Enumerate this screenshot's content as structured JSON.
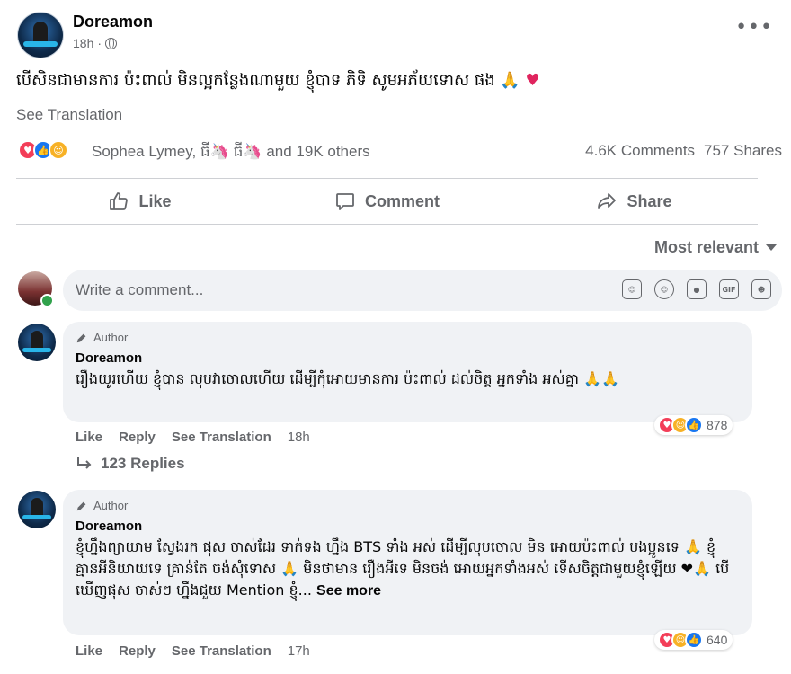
{
  "post": {
    "author": "Doreamon",
    "time": "18h",
    "text": "បើសិនជាមានការ ប៉ះពាល់ មិនល្អកន្លែងណាមួយ ខ្ញុំបាទ ភិទិ សូមអភ័យទោស ផង 🙏",
    "heart": "♥",
    "see_translation": "See Translation",
    "reactors": "Sophea Lymey, ធី🦄 ធី🦄 and 19K others",
    "comments_count": "4.6K Comments",
    "shares_count": "757 Shares",
    "reaction_icons": [
      "love-icon",
      "like-icon",
      "care-icon"
    ],
    "accent_color": "#1877f2"
  },
  "actions": {
    "like": "Like",
    "comment": "Comment",
    "share": "Share"
  },
  "sort": {
    "label": "Most relevant"
  },
  "composer": {
    "placeholder": "Write a comment...",
    "icons": [
      "avatar-sticker-icon",
      "emoji-icon",
      "camera-icon",
      "gif-icon",
      "sticker-icon"
    ],
    "gif_label": "GIF"
  },
  "comments": [
    {
      "badge": "Author",
      "name": "Doreamon",
      "text": "រឿងយូរហើយ ខ្ញុំបាន លុបវាចោលហើយ ដើម្បីកុំអោយមានការ ប៉ះពាល់ ដល់ចិត្ត អ្នកទាំង អស់គ្នា 🙏🙏",
      "like": "Like",
      "reply": "Reply",
      "see_translation": "See Translation",
      "time": "18h",
      "reaction_count": "878",
      "reaction_icons": [
        "love-icon",
        "haha-icon",
        "like-icon"
      ]
    },
    {
      "badge": "Author",
      "name": "Doreamon",
      "text": "ខ្ញុំហ្នឹងព្យាយាម ស្វែងរក ផុស ចាស់ដែរ ទាក់ទង ហ្នឹង BTS ទាំង អស់ ដើម្បីលុបចោល មិន អោយប៉ះពាល់ បងប្អូនទេ 🙏 ខ្ញុំគ្មានអីនិយាយទេ គ្រាន់តែ ចង់សុំទោស 🙏 មិនថាមាន រឿងអីទេ មិនចង់ អោយអ្នកទាំងអស់ ទើសចិត្តជាមួយខ្ញុំឡើយ ❤🙏 បើឃើញផុស ចាស់ៗ ហ្នឹងជួយ Mention ខ្ញុំ...",
      "see_more": "See more",
      "like": "Like",
      "reply": "Reply",
      "see_translation": "See Translation",
      "time": "17h",
      "reaction_count": "640",
      "reaction_icons": [
        "love-icon",
        "haha-icon",
        "like-icon"
      ]
    }
  ],
  "replies": {
    "label": "123 Replies"
  }
}
